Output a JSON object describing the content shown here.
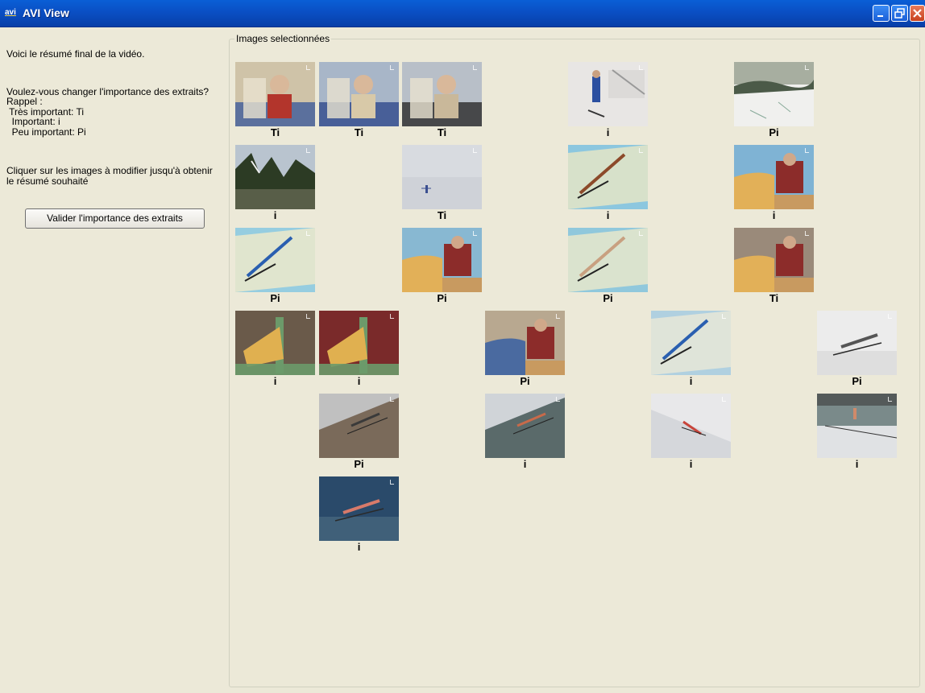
{
  "window": {
    "icon_text": "avi",
    "title": "AVI View"
  },
  "left": {
    "intro": "Voici le résumé final de la vidéo.",
    "question": "Voulez-vous changer l'importance des extraits?",
    "reminder": "Rappel :",
    "legend": [
      " Très important: Ti",
      "  Important: i",
      "  Peu important: Pi"
    ],
    "instruction_line1": "Cliquer sur les images à modifier jusqu'à obtenir",
    "instruction_line2": "le résumé souhaité",
    "validate_button": "Valider l'importance des extraits"
  },
  "panel": {
    "title": "Images selectionnées"
  },
  "thumbnails": [
    {
      "label": "Ti",
      "scene": "skier-closeup",
      "colors": [
        "#cfc3a8",
        "#3d5b9a",
        "#b3352c"
      ]
    },
    {
      "label": "Ti",
      "scene": "skier-closeup",
      "colors": [
        "#a8b6c8",
        "#2f4a8c",
        "#d8c9a8"
      ]
    },
    {
      "label": "Ti",
      "scene": "skier-closeup",
      "colors": [
        "#b8bfc8",
        "#2a2a2a",
        "#c9b89a"
      ]
    },
    {
      "label": "i",
      "scene": "skier-snow",
      "colors": [
        "#e8e6e4",
        "#c8c6c4",
        "#2b4fa0"
      ]
    },
    {
      "label": "Pi",
      "scene": "snow-trees",
      "colors": [
        "#f0f0ee",
        "#4b5a48",
        "#a7aea0"
      ]
    },
    {
      "label": "i",
      "scene": "forest-blur",
      "colors": [
        "#b9c4cf",
        "#2c3b24",
        "#6b6e58"
      ]
    },
    {
      "label": "Ti",
      "scene": "snow-plain",
      "colors": [
        "#d8dbe0",
        "#cfd2d8",
        "#3b4f90"
      ]
    },
    {
      "label": "i",
      "scene": "model-ramp",
      "colors": [
        "#8cc7df",
        "#dfe3c8",
        "#8c4a2a"
      ]
    },
    {
      "label": "i",
      "scene": "studio",
      "colors": [
        "#7fb3d4",
        "#8c2c2a",
        "#e2b058"
      ]
    },
    {
      "label": "Pi",
      "scene": "model-ramp",
      "colors": [
        "#96cde0",
        "#e8e8cc",
        "#2a5fb0"
      ]
    },
    {
      "label": "Pi",
      "scene": "studio",
      "colors": [
        "#88b8d2",
        "#8c2c2a",
        "#e2b058"
      ]
    },
    {
      "label": "Pi",
      "scene": "model-ramp",
      "colors": [
        "#90c8dc",
        "#e2e6cc",
        "#c8a080"
      ]
    },
    {
      "label": "Ti",
      "scene": "studio",
      "colors": [
        "#9a8a7a",
        "#8c2c2a",
        "#e2b058"
      ]
    },
    {
      "label": "i",
      "scene": "hands-model",
      "colors": [
        "#6a5a4a",
        "#6c9a6a",
        "#e0b050"
      ]
    },
    {
      "label": "i",
      "scene": "hands-model",
      "colors": [
        "#7a2a2a",
        "#6c9a6a",
        "#e0b050"
      ]
    },
    {
      "label": "Pi",
      "scene": "studio",
      "colors": [
        "#b8a890",
        "#8c2c2a",
        "#4a6aa0"
      ]
    },
    {
      "label": "i",
      "scene": "model-ramp",
      "colors": [
        "#b0d0e0",
        "#e4e6d8",
        "#2a5fb0"
      ]
    },
    {
      "label": "Pi",
      "scene": "jumper-sky",
      "colors": [
        "#ececec",
        "#d8d8d8",
        "#555555"
      ]
    },
    {
      "label": "Pi",
      "scene": "jumper-slope",
      "colors": [
        "#7a6a5a",
        "#c0c0c0",
        "#3a3a3a"
      ]
    },
    {
      "label": "i",
      "scene": "jumper-slope",
      "colors": [
        "#5a6a6a",
        "#d0d4d8",
        "#c86a4a"
      ]
    },
    {
      "label": "i",
      "scene": "jumper-snow",
      "colors": [
        "#e8e8ea",
        "#c8ccd0",
        "#c8443a"
      ]
    },
    {
      "label": "i",
      "scene": "jump-hill",
      "colors": [
        "#7a8a8a",
        "#e0e2e4",
        "#3a3a3a"
      ]
    },
    {
      "label": "i",
      "scene": "jumper-sky",
      "colors": [
        "#2a4a6a",
        "#4a6a80",
        "#d87a6a"
      ]
    }
  ]
}
